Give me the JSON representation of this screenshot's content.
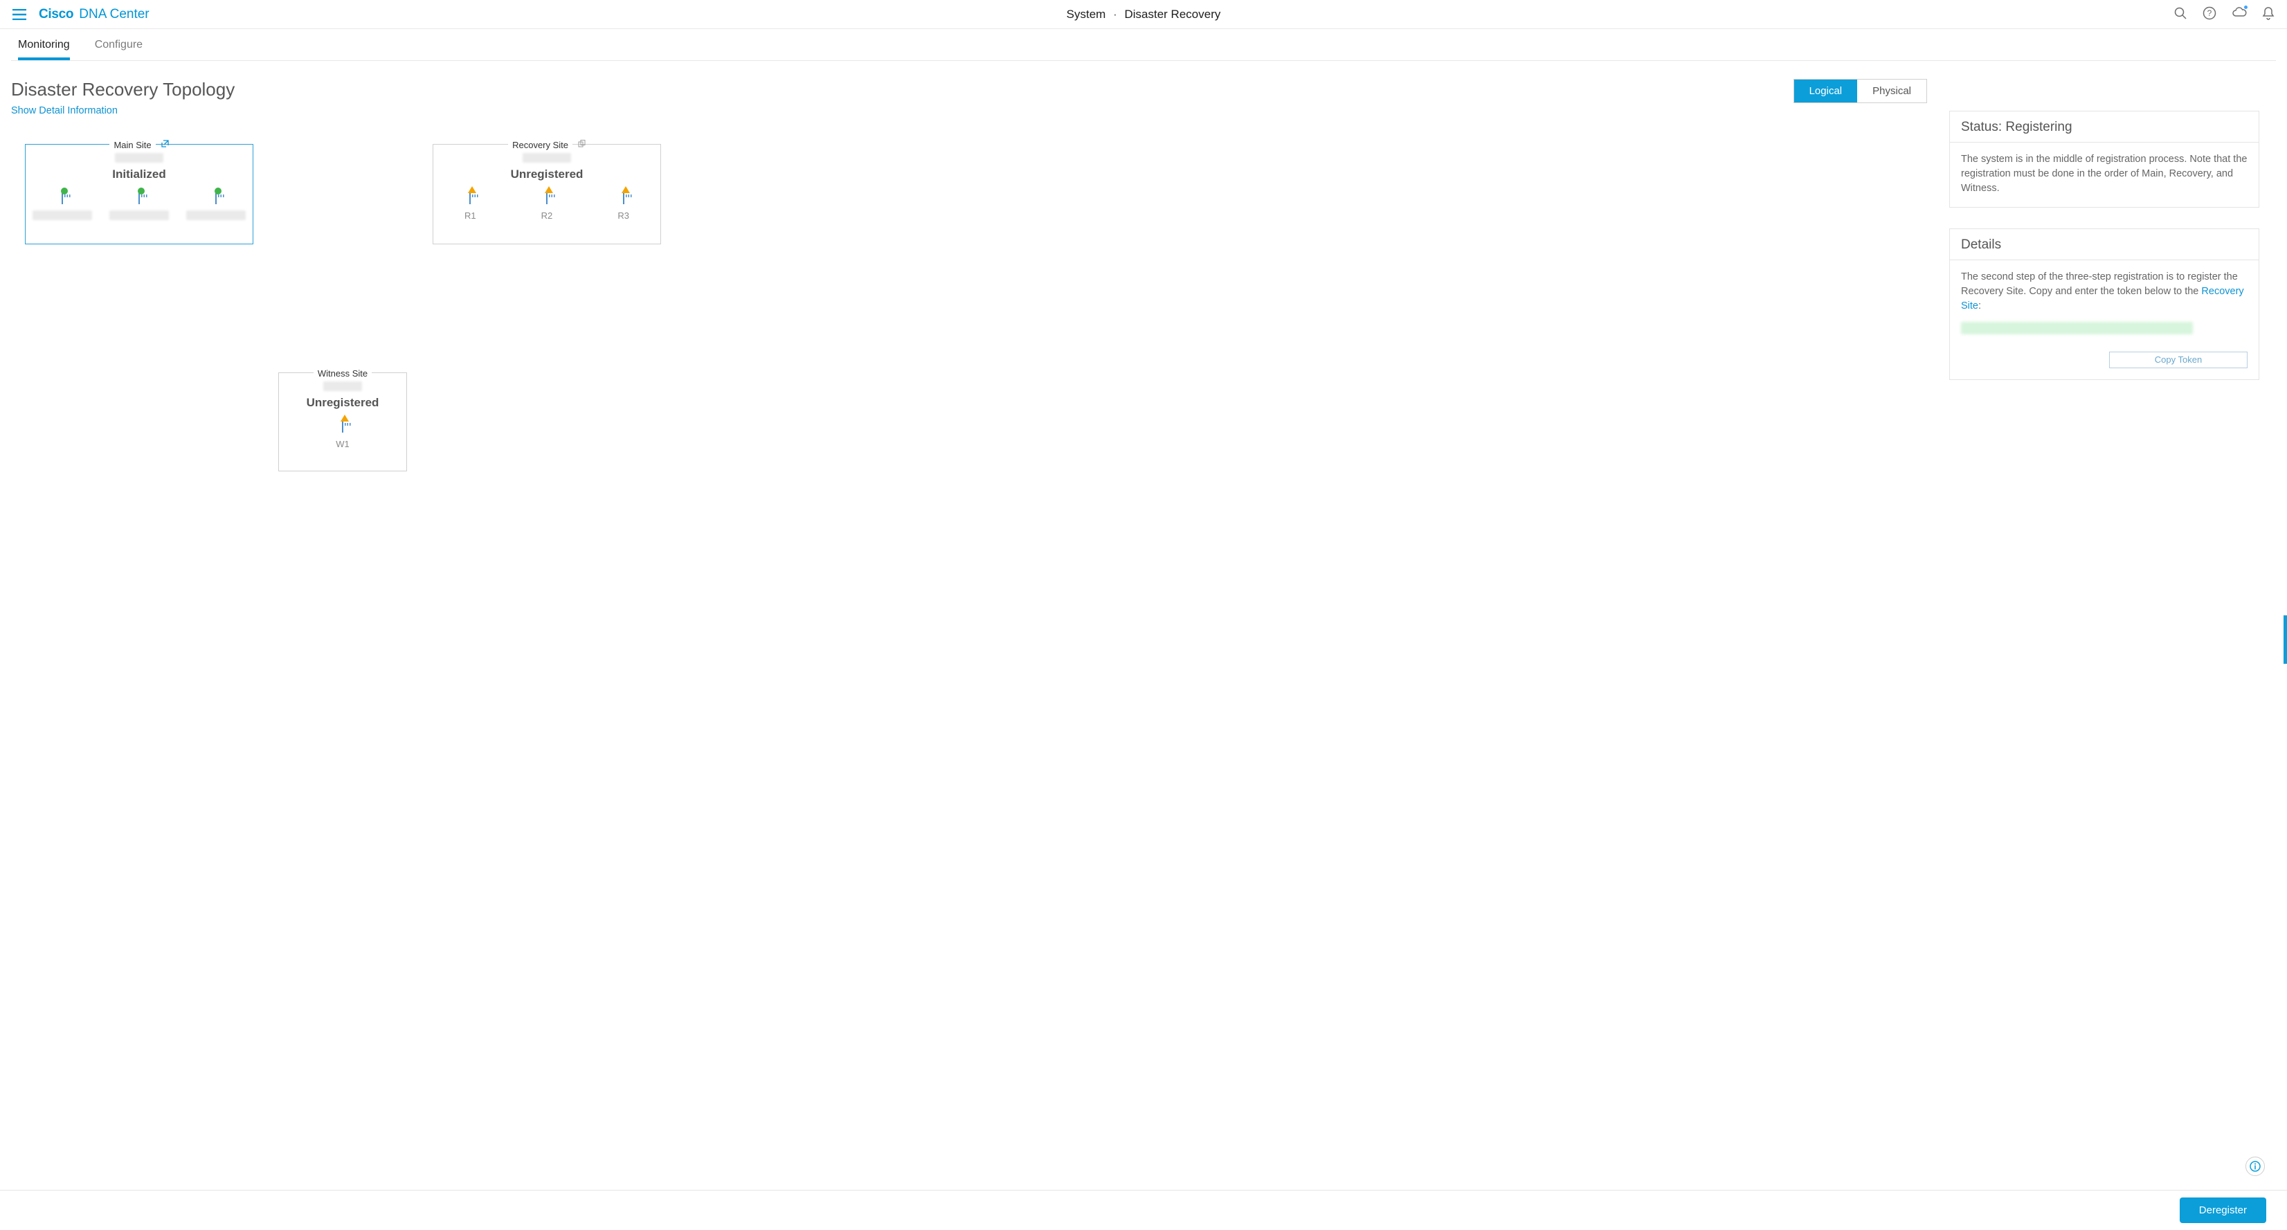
{
  "brand": {
    "cisco": "Cisco",
    "product": "DNA Center"
  },
  "breadcrumb": {
    "section": "System",
    "page": "Disaster Recovery"
  },
  "tabs": {
    "monitoring": "Monitoring",
    "configure": "Configure"
  },
  "page": {
    "title": "Disaster Recovery Topology",
    "showDetail": "Show Detail Information"
  },
  "viewToggle": {
    "logical": "Logical",
    "physical": "Physical"
  },
  "sites": {
    "main": {
      "label": "Main Site",
      "status": "Initialized",
      "nodes": [
        "",
        "",
        ""
      ]
    },
    "recovery": {
      "label": "Recovery Site",
      "status": "Unregistered",
      "nodes": [
        "R1",
        "R2",
        "R3"
      ]
    },
    "witness": {
      "label": "Witness Site",
      "status": "Unregistered",
      "nodes": [
        "W1"
      ]
    }
  },
  "statusPanel": {
    "title": "Status: Registering",
    "body": "The system is in the middle of registration process. Note that the registration must be done in the order of Main, Recovery, and Witness."
  },
  "detailsPanel": {
    "title": "Details",
    "body_pre": "The second step of the three-step registration is to register the Recovery Site. Copy and enter the token below to the ",
    "link": "Recovery Site",
    "body_post": ":",
    "copyBtn": "Copy Token"
  },
  "footer": {
    "deregister": "Deregister"
  }
}
